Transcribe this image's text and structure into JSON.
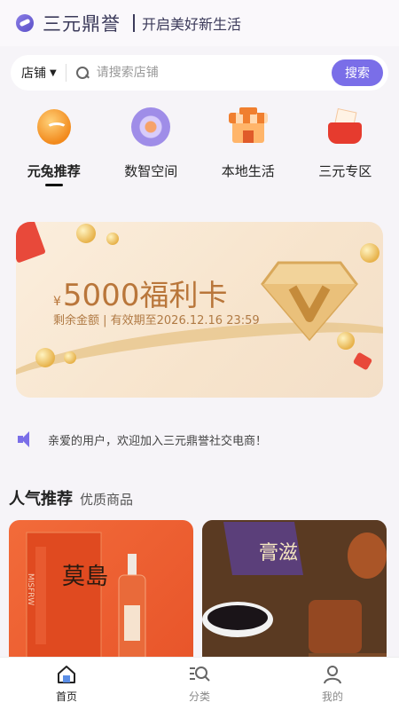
{
  "header": {
    "brand": "三元鼎誉",
    "slogan": "开启美好新生活"
  },
  "search": {
    "scope": "店铺",
    "placeholder": "请搜索店铺",
    "button": "搜索"
  },
  "categories": [
    {
      "label": "元兔推荐",
      "icon": "rabbit-coin-icon",
      "active": true
    },
    {
      "label": "数智空间",
      "icon": "digital-ring-icon",
      "active": false
    },
    {
      "label": "本地生活",
      "icon": "store-icon",
      "active": false
    },
    {
      "label": "三元专区",
      "icon": "red-envelope-gift-icon",
      "active": false
    }
  ],
  "banner": {
    "currency": "¥",
    "amount": "5000",
    "card_name": "福利卡",
    "subtitle": "剩余金额 | 有效期至2026.12.16 23:59"
  },
  "notice": {
    "text": "亲爱的用户，欢迎加入三元鼎誉社交电商！"
  },
  "section": {
    "title": "人气推荐",
    "subtitle": "优质商品"
  },
  "products": [
    {
      "box_text": "莫島",
      "box_side": "MISFRW"
    },
    {
      "box_text": "膏滋"
    }
  ],
  "tabs": [
    {
      "label": "首页",
      "icon": "home-icon",
      "active": true
    },
    {
      "label": "分类",
      "icon": "category-search-icon",
      "active": false
    },
    {
      "label": "我的",
      "icon": "user-icon",
      "active": false
    }
  ],
  "colors": {
    "accent": "#7a6ee8",
    "banner_text": "#b9763a",
    "brand": "#3b3a5a"
  }
}
